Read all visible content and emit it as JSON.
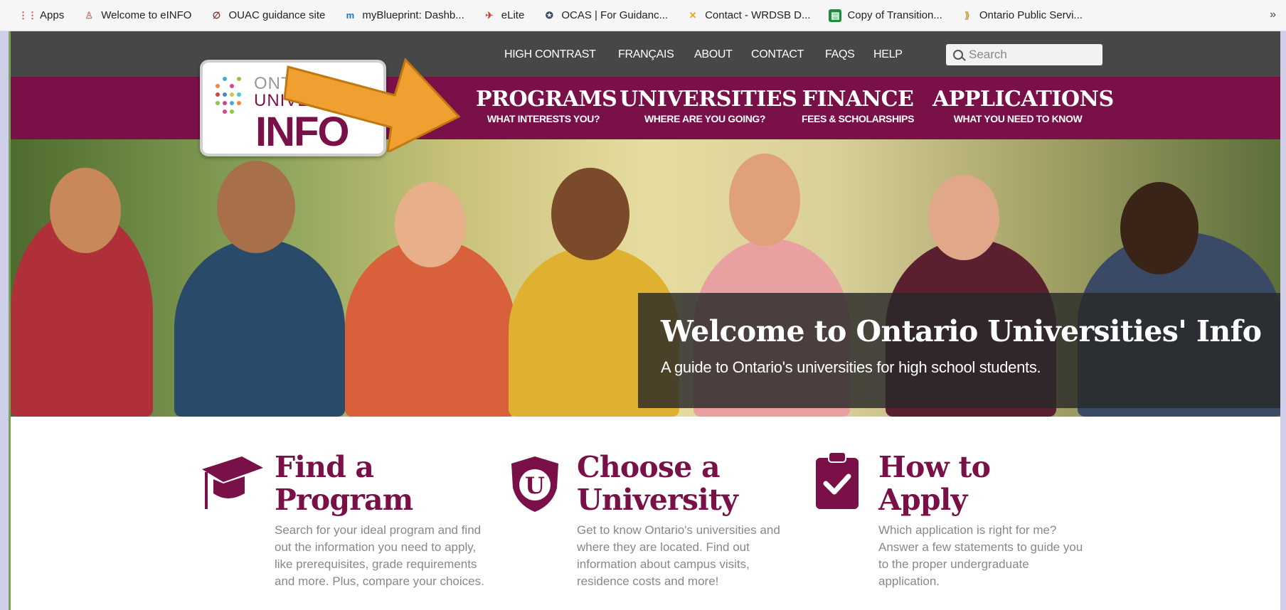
{
  "bookmarks": [
    {
      "label": "Apps",
      "icon": "apps-grid-icon"
    },
    {
      "label": "Welcome to eINFO",
      "icon": "einfo-icon"
    },
    {
      "label": "OUAC guidance site",
      "icon": "ouac-icon"
    },
    {
      "label": "myBlueprint: Dashb...",
      "icon": "myblueprint-icon"
    },
    {
      "label": "eLite",
      "icon": "elite-icon"
    },
    {
      "label": "OCAS | For Guidanc...",
      "icon": "ocas-icon"
    },
    {
      "label": "Contact - WRDSB D...",
      "icon": "wrdsb-icon"
    },
    {
      "label": "Copy of Transition...",
      "icon": "sheets-icon"
    },
    {
      "label": "Ontario Public Servi...",
      "icon": "ontario-icon"
    }
  ],
  "bookmarks_more": "»",
  "utility": {
    "high_contrast": "HIGH CONTRAST",
    "francais": "FRANÇAIS",
    "about": "ABOUT",
    "contact": "CONTACT",
    "faqs": "FAQS",
    "help": "HELP",
    "search_placeholder": "Search"
  },
  "logo": {
    "line1": "ONTARIO",
    "line2": "UNIVERSITIES",
    "line3": "INFO"
  },
  "nav": [
    {
      "title": "PROGRAMS",
      "sub": "WHAT INTERESTS YOU?"
    },
    {
      "title": "UNIVERSITIES",
      "sub": "WHERE ARE YOU GOING?"
    },
    {
      "title": "FINANCE",
      "sub": "FEES & SCHOLARSHIPS"
    },
    {
      "title": "APPLICATIONS",
      "sub": "WHAT YOU NEED TO KNOW"
    }
  ],
  "hero": {
    "title": "Welcome to Ontario Universities' Info",
    "subtitle": "A guide to Ontario's universities for high school students."
  },
  "features": [
    {
      "title1": "Find a",
      "title2": "Program",
      "desc": "Search for your ideal program and find out the information you need to apply, like prerequisites, grade requirements and more. Plus, compare your choices.",
      "icon": "graduation-cap-icon"
    },
    {
      "title1": "Choose a",
      "title2": "University",
      "desc": "Get to know Ontario's universities and where they are located. Find out information about campus visits, residence costs and more!",
      "icon": "university-shield-icon"
    },
    {
      "title1": "How to",
      "title2": "Apply",
      "desc": "Which application is right for me? Answer a few statements to guide you to the proper undergraduate application.",
      "icon": "clipboard-check-icon"
    }
  ],
  "colors": {
    "brand": "#7a1048",
    "utility_bar": "#474747",
    "arrow": "#f0a030"
  }
}
